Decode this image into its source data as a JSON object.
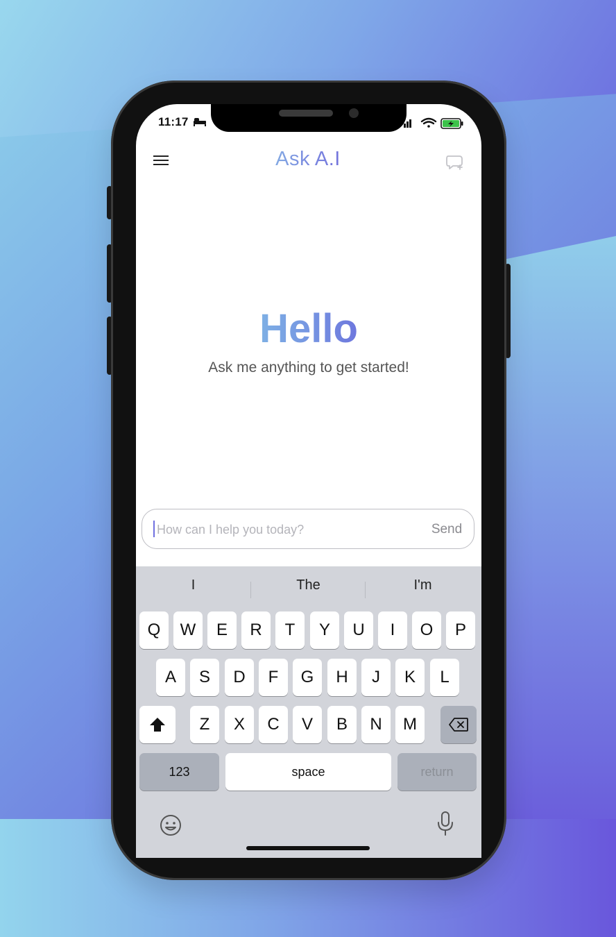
{
  "status_bar": {
    "time": "11:17"
  },
  "header": {
    "title": "Ask A.I"
  },
  "main": {
    "heading": "Hello",
    "subheading": "Ask me anything to get started!"
  },
  "composer": {
    "placeholder": "How can I help you today?",
    "value": "",
    "send_label": "Send"
  },
  "keyboard": {
    "suggestions": [
      "I",
      "The",
      "I'm"
    ],
    "row1": [
      "Q",
      "W",
      "E",
      "R",
      "T",
      "Y",
      "U",
      "I",
      "O",
      "P"
    ],
    "row2": [
      "A",
      "S",
      "D",
      "F",
      "G",
      "H",
      "J",
      "K",
      "L"
    ],
    "row3": [
      "Z",
      "X",
      "C",
      "V",
      "B",
      "N",
      "M"
    ],
    "numbers_label": "123",
    "space_label": "space",
    "return_label": "return"
  },
  "colors": {
    "accent_start": "#87cbe7",
    "accent_end": "#6556d8"
  }
}
